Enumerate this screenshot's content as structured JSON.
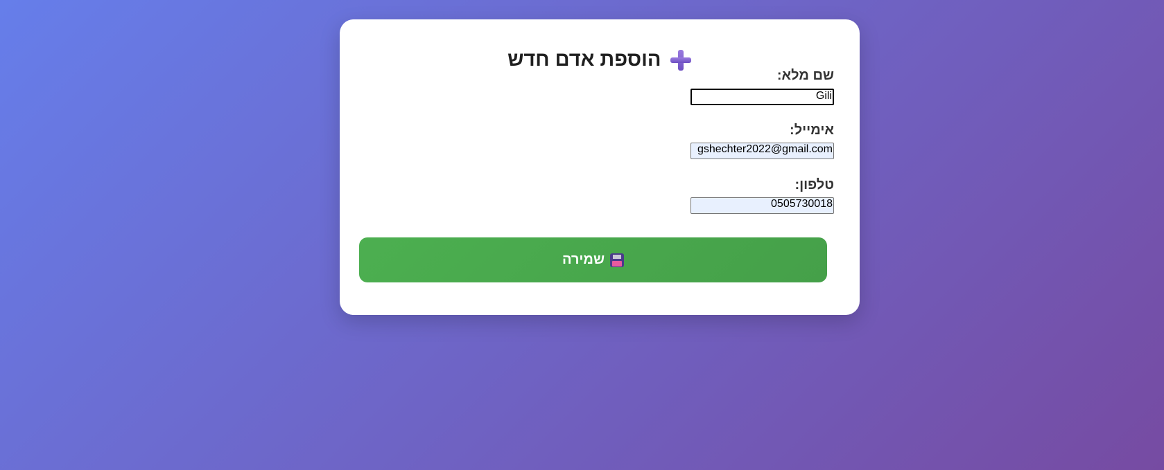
{
  "form": {
    "title": "הוספת אדם חדש",
    "title_icon": "heavy-plus-icon",
    "fields": [
      {
        "label": "שם מלא:",
        "value": "Gili"
      },
      {
        "label": "אימייל:",
        "value": "gshechter2022@gmail.com"
      },
      {
        "label": "טלפון:",
        "value": "0505730018"
      }
    ],
    "save_label": "שמירה",
    "save_icon": "floppy-disk-icon"
  },
  "colors": {
    "background_start": "#667eea",
    "background_end": "#764ba2",
    "save_button": "#4caf50",
    "autofill_field": "#e8f0fe"
  }
}
